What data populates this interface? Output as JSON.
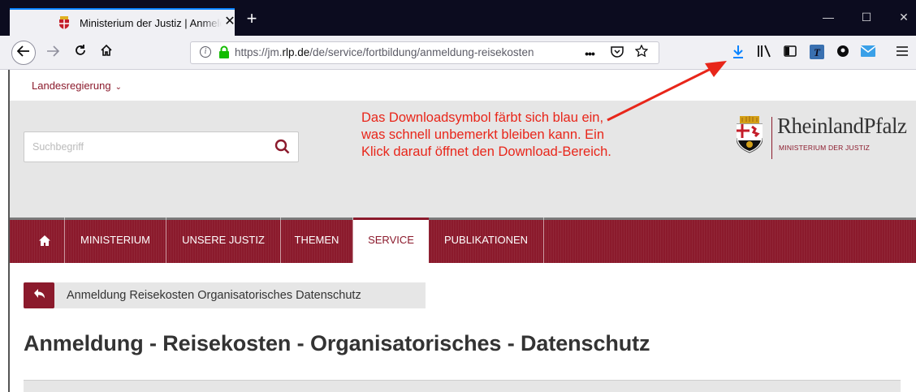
{
  "browser": {
    "tab_title": "Ministerium der Justiz | Anmeldung",
    "tab_close": "✕",
    "new_tab": "+",
    "window_controls": {
      "minimize": "—",
      "maximize": "☐",
      "close": "✕"
    },
    "url_prefix": "https://jm.",
    "url_host": "rlp.de",
    "url_path": "/de/service/fortbildung/anmeldung-reisekosten",
    "page_actions": [
      "•••",
      "pocket-icon",
      "star-icon"
    ],
    "toolbar_icons": [
      "download-icon",
      "library-icon",
      "sidebar-icon",
      "extension-icon",
      "account-icon",
      "mail-icon",
      "menu-icon"
    ],
    "download_color": "#0a84ff"
  },
  "site": {
    "top_link": "Landesregierung",
    "search_placeholder": "Suchbegriff",
    "logo_name": "RheinlandPfalz",
    "logo_sub": "MINISTERIUM DER JUSTIZ",
    "brand_color": "#8b1a2c",
    "menu": [
      {
        "label": "MINISTERIUM"
      },
      {
        "label": "UNSERE JUSTIZ"
      },
      {
        "label": "THEMEN"
      },
      {
        "label": "SERVICE",
        "active": true
      },
      {
        "label": "PUBLIKATIONEN"
      }
    ],
    "breadcrumb": "Anmeldung Reisekosten Organisatorisches Datenschutz",
    "page_title": "Anmeldung - Reisekosten - Organisatorisches - Datenschutz"
  },
  "annotation": {
    "text": "Das Downloadsymbol färbt sich blau ein, was schnell unbemerkt bleiben kann. Ein Klick darauf öffnet den Download-Bereich.",
    "color": "#e8261a"
  }
}
